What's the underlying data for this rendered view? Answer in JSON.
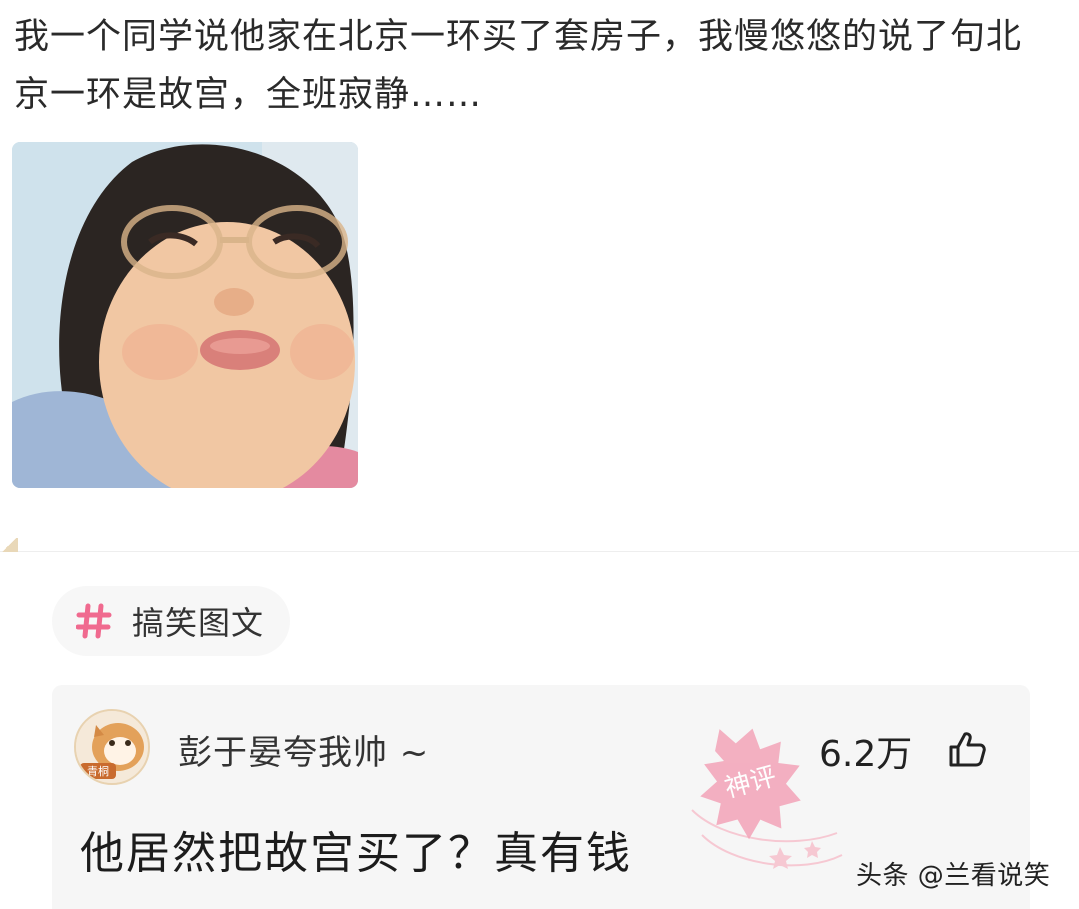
{
  "post": {
    "text": "我一个同学说他家在北京一环买了套房子，我慢悠悠的说了句北京一环是故宫，全班寂静……",
    "image_icon": "reaction-meme-photo"
  },
  "topic": {
    "icon": "hash-icon",
    "label": "搞笑图文",
    "accent": "#f06a8f"
  },
  "comment": {
    "avatar_badge": "青桐",
    "username": "彭于晏夸我帅 ~",
    "likes": "6.2万",
    "like_icon": "thumbs-up-icon",
    "badge": "神评",
    "text": "他居然把故宫买了？真有钱"
  },
  "watermark": "头条 @兰看说笑"
}
